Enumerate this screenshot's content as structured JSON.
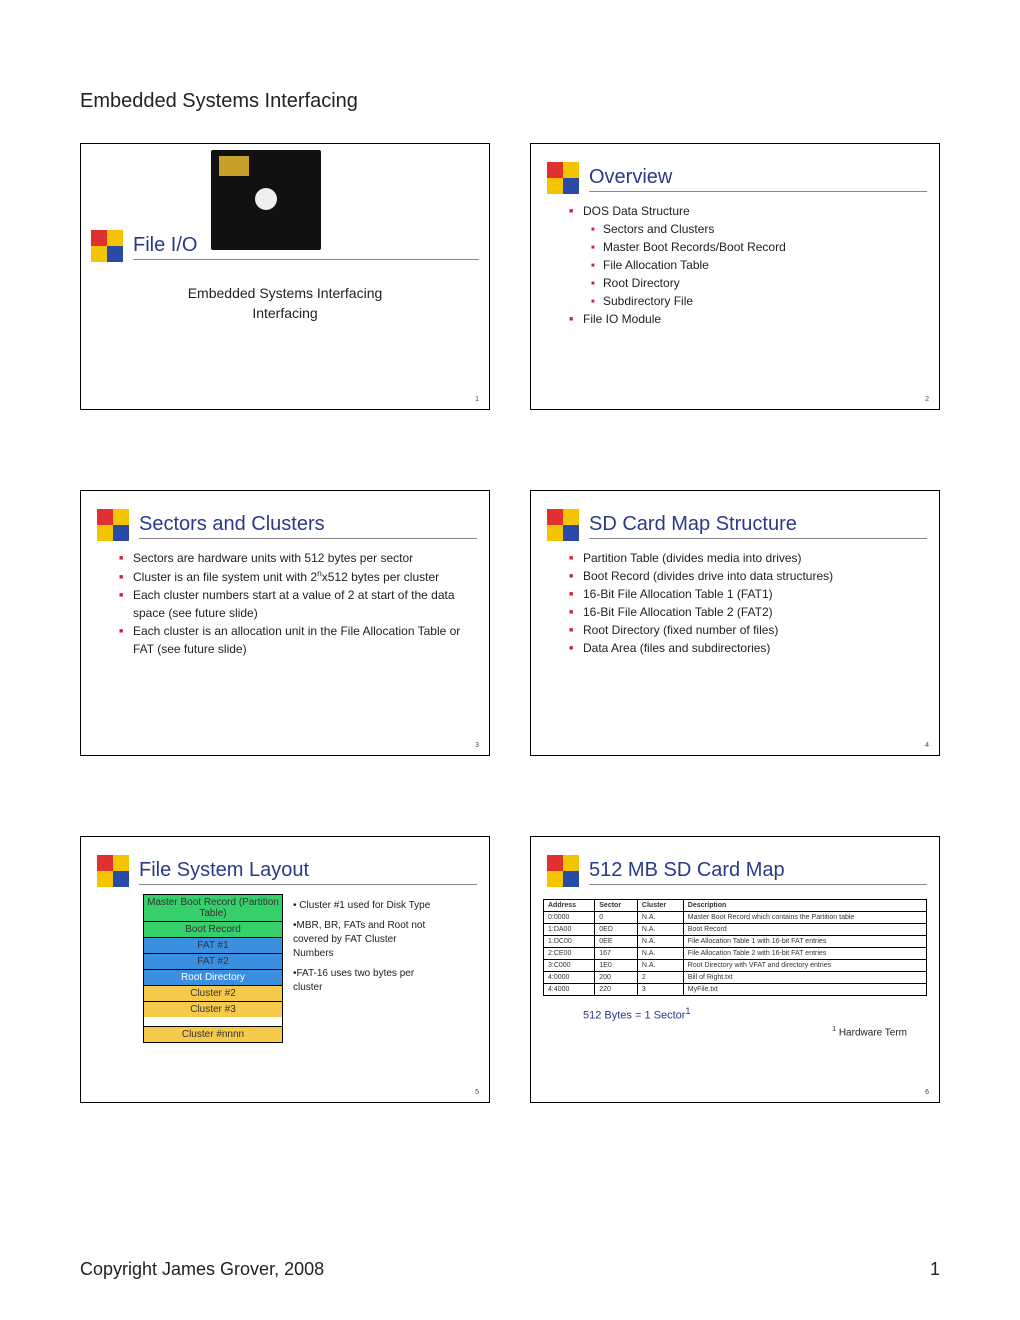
{
  "header": "Embedded Systems Interfacing",
  "footer": {
    "copyright": "Copyright James Grover, 2008",
    "page": "1"
  },
  "slides": {
    "s1": {
      "num": "1",
      "title": "File I/O",
      "sub1": "Embedded Systems Interfacing",
      "sub2": "Interfacing"
    },
    "s2": {
      "num": "2",
      "title": "Overview",
      "b1": "DOS Data Structure",
      "b1a": "Sectors and Clusters",
      "b1b": "Master Boot Records/Boot Record",
      "b1c": "File Allocation Table",
      "b1d": "Root Directory",
      "b1e": "Subdirectory File",
      "b2": "File IO Module"
    },
    "s3": {
      "num": "3",
      "title": "Sectors and Clusters",
      "b1": "Sectors are hardware units with 512 bytes per sector",
      "b2_pre": "Cluster is an file system unit with 2",
      "b2_exp": "n",
      "b2_post": "x512 bytes per cluster",
      "b3": "Each cluster numbers start at a value of 2 at start of the data space (see future slide)",
      "b4": "Each cluster is an allocation unit in the File Allocation Table or FAT (see future slide)"
    },
    "s4": {
      "num": "4",
      "title": "SD Card Map Structure",
      "b1": "Partition Table (divides media into drives)",
      "b2": "Boot Record (divides drive into data structures)",
      "b3": "16-Bit File Allocation Table 1 (FAT1)",
      "b4": "16-Bit File Allocation Table 2 (FAT2)",
      "b5": "Root Directory (fixed number of files)",
      "b6": "Data Area (files and subdirectories)"
    },
    "s5": {
      "num": "5",
      "title": "File System Layout",
      "r1": "Master Boot Record (Partition Table)",
      "r2": "Boot Record",
      "r3": "FAT #1",
      "r4": "FAT #2",
      "r5": "Root Directory",
      "r6": "Cluster #2",
      "r7": "Cluster #3",
      "r8": "Cluster #nnnn",
      "n1": "• Cluster #1 used for Disk Type",
      "n2": "•MBR, BR, FATs and Root not covered by FAT Cluster Numbers",
      "n3": "•FAT-16 uses two bytes per cluster"
    },
    "s6": {
      "num": "6",
      "title": "512 MB SD Card Map",
      "hdr": {
        "c1": "Address",
        "c2": "Sector",
        "c3": "Cluster",
        "c4": "Description"
      },
      "rows": [
        {
          "c1": "0:0000",
          "c2": "0",
          "c3": "N.A.",
          "c4": "Master Boot Record which contains the Partition table"
        },
        {
          "c1": "1:DA00",
          "c2": "0ED",
          "c3": "N.A.",
          "c4": "Boot Record"
        },
        {
          "c1": "1:DC00",
          "c2": "0EE",
          "c3": "N.A.",
          "c4": "File Allocation Table 1 with 16-bit FAT entries"
        },
        {
          "c1": "2:CE00",
          "c2": "167",
          "c3": "N.A.",
          "c4": "File Allocation Table 2 with 16-bit FAT entries"
        },
        {
          "c1": "3:C000",
          "c2": "1E0",
          "c3": "N.A.",
          "c4": "Root Directory with VFAT and directory entries"
        },
        {
          "c1": "4:0000",
          "c2": "200",
          "c3": "2",
          "c4": "Bill of Right.txt"
        },
        {
          "c1": "4:4000",
          "c2": "220",
          "c3": "3",
          "c4": "MyFile.txt"
        }
      ],
      "note1_pre": "512 Bytes = 1 Sector",
      "note1_sup": "1",
      "note2_sup": "1",
      "note2": " Hardware Term"
    }
  }
}
